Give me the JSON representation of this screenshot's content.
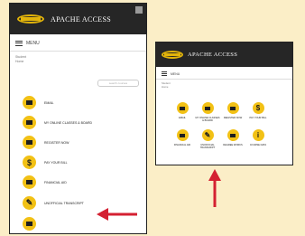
{
  "brand": "APACHE ACCESS",
  "menu_label": "MENU",
  "breadcrumb": [
    "Student",
    "Home"
  ],
  "search_placeholder": "search courses",
  "phone_items": [
    {
      "label": "EMAIL",
      "icon": "envelope-icon",
      "glyph": ""
    },
    {
      "label": "MY ONLINE CLASSES & BOARD",
      "icon": "laptop-icon",
      "glyph": ""
    },
    {
      "label": "REGISTER NOW",
      "icon": "bus-icon",
      "glyph": ""
    },
    {
      "label": "PAY YOUR BILL",
      "icon": "dollar-icon",
      "glyph": "$"
    },
    {
      "label": "FINANCIAL AID",
      "icon": "bank-icon",
      "glyph": ""
    },
    {
      "label": "UNOFFICIAL TRANSCRIPT",
      "icon": "pencil-icon",
      "glyph": "✎"
    },
    {
      "label": "",
      "icon": "partial-icon",
      "glyph": ""
    }
  ],
  "desk_items": [
    {
      "label": "EMAIL",
      "icon": "envelope-icon",
      "glyph": ""
    },
    {
      "label": "MY ONLINE CLASSES & BOARD",
      "icon": "laptop-icon",
      "glyph": ""
    },
    {
      "label": "REGISTER NOW",
      "icon": "bus-icon",
      "glyph": ""
    },
    {
      "label": "PAY YOUR BILL",
      "icon": "dollar-icon",
      "glyph": "$"
    },
    {
      "label": "FINANCIAL AID",
      "icon": "bank-icon",
      "glyph": ""
    },
    {
      "label": "UNOFFICIAL TRANSCRIPT",
      "icon": "pencil-icon",
      "glyph": "✎"
    },
    {
      "label": "DEGREE WORKS",
      "icon": "graduation-icon",
      "glyph": ""
    },
    {
      "label": "COURSE DATA",
      "icon": "info-icon",
      "glyph": "i"
    }
  ],
  "colors": {
    "accent": "#f2c115",
    "header": "#262626",
    "arrow": "#d42031",
    "background": "#fbeec7"
  }
}
